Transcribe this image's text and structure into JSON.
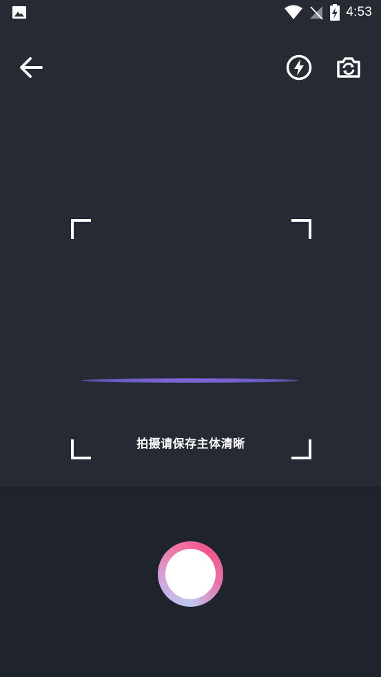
{
  "status_bar": {
    "time": "4:53",
    "left_icon": "image-icon",
    "icons": [
      "wifi-icon",
      "no-signal-icon",
      "battery-charging-icon"
    ]
  },
  "toolbar": {
    "back_icon": "arrow-left-icon",
    "flash_icon": "flash-circle-icon",
    "switch_camera_icon": "camera-switch-icon"
  },
  "scan": {
    "hint": "拍摄请保存主体清晰",
    "scan_line_color": "#7b63d0"
  },
  "shutter": {
    "gradient_colors": [
      "#bfc7ef",
      "#f2568c"
    ],
    "inner_color": "#ffffff"
  },
  "colors": {
    "background": "#252a33",
    "bottom_panel": "#1f232b"
  }
}
